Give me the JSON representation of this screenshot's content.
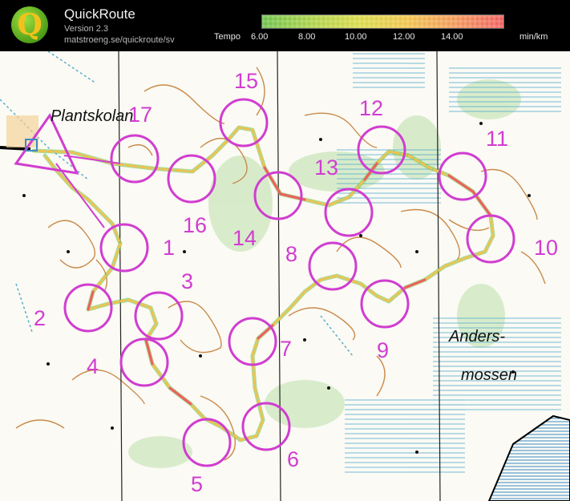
{
  "app": {
    "name": "QuickRoute",
    "version": "Version 2.3",
    "url": "matstroeng.se/quickroute/sv",
    "logo_letter": "Q"
  },
  "legend": {
    "label": "Tempo",
    "ticks": [
      "6.00",
      "8.00",
      "10.00",
      "12.00",
      "14.00"
    ],
    "unit": "min/km",
    "colors": [
      "#6abf4b",
      "#d7d94a",
      "#f0c24e",
      "#f1955a",
      "#ee5f5f"
    ]
  },
  "map": {
    "places": {
      "plantskolan": "Plantskolan",
      "anders": "Anders-",
      "mossen": "mossen"
    },
    "controls": [
      "1",
      "2",
      "3",
      "4",
      "5",
      "6",
      "7",
      "8",
      "9",
      "10",
      "11",
      "12",
      "13",
      "14",
      "15",
      "16",
      "17"
    ],
    "colors": {
      "control": "#d03dd0",
      "water": "#5aaed0",
      "contour": "#c98a4a",
      "vegetation": "#cfe8c0"
    }
  }
}
